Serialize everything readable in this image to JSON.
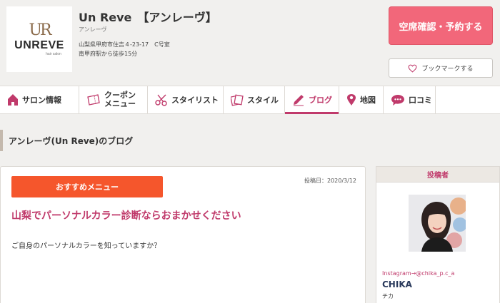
{
  "colors": {
    "accent": "#c03a6b",
    "reserve": "#f2677a",
    "category": "#f5562c",
    "page_bg": "#f1f0ee"
  },
  "salon": {
    "logo_mono": "UR",
    "logo_brand": "UNREVE",
    "logo_sub": "hair salon",
    "name": "Un Reve　【アンレーヴ】",
    "kana": "アンレーヴ",
    "address": "山梨県甲府市住吉４-23-17　C号室",
    "access": "南甲府駅から徒歩15分"
  },
  "actions": {
    "reserve_label": "空席確認・予約する",
    "bookmark_label": "ブックマークする"
  },
  "tabs": [
    {
      "label": "サロン情報",
      "icon": "home-icon"
    },
    {
      "label_line1": "クーポン",
      "label_line2": "メニュー",
      "icon": "ticket-icon"
    },
    {
      "label": "スタイリスト",
      "icon": "scissors-icon"
    },
    {
      "label": "スタイル",
      "icon": "cards-icon"
    },
    {
      "label": "ブログ",
      "icon": "pencil-icon",
      "active": true
    },
    {
      "label": "地図",
      "icon": "map-pin-icon"
    },
    {
      "label": "口コミ",
      "icon": "speech-bubble-icon"
    }
  ],
  "section": {
    "title": "アンレーヴ(Un Reve)のブログ"
  },
  "post": {
    "category": "おすすめメニュー",
    "date": "投稿日：2020/3/12",
    "title": "山梨でパーソナルカラー診断ならおまかせください",
    "body": "ご自身のパーソナルカラーを知っていますか？"
  },
  "author": {
    "heading": "投稿者",
    "instagram": "Instagram→@chika_p.c_a",
    "name": "CHIKA",
    "kana": "チカ"
  }
}
